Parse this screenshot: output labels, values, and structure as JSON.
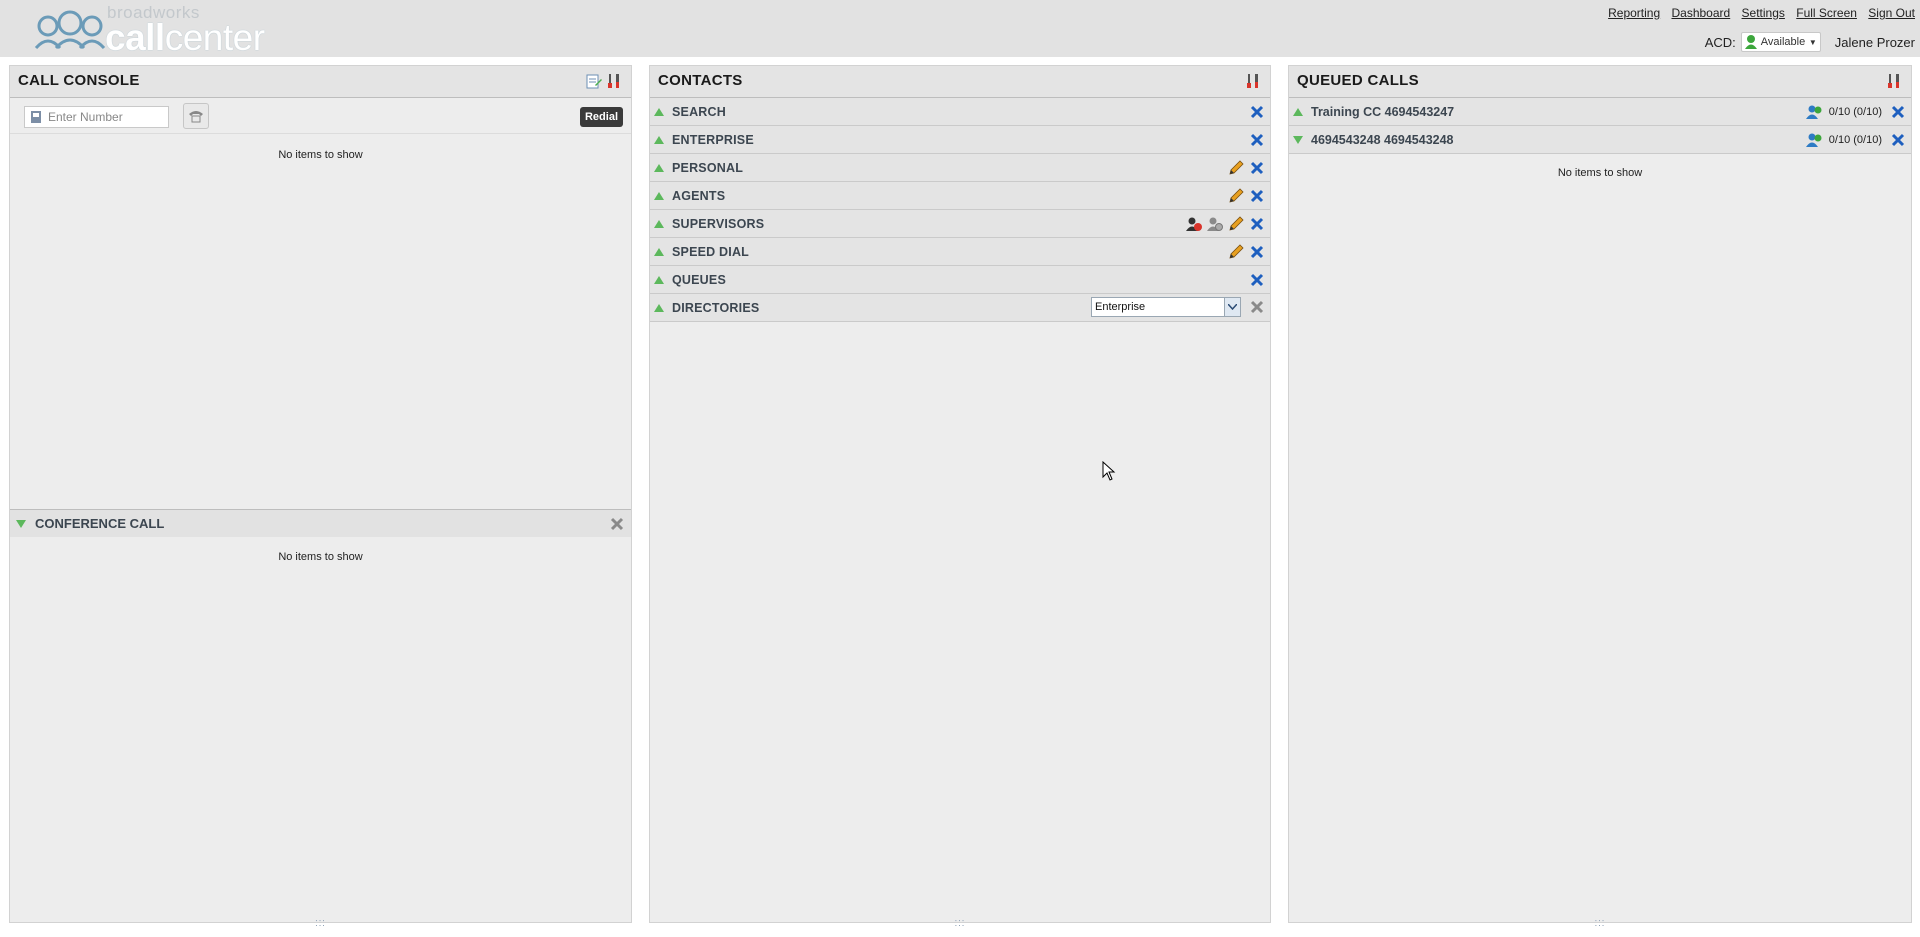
{
  "header": {
    "logo_small": "broadworks",
    "logo_big_prefix": "call",
    "logo_big_suffix": "center",
    "links": [
      "Reporting",
      "Dashboard",
      "Settings",
      "Full Screen",
      "Sign Out"
    ],
    "acd_label": "ACD:",
    "acd_status": "Available",
    "user_name": "Jalene Prozer"
  },
  "call_console": {
    "title": "CALL CONSOLE",
    "number_placeholder": "Enter Number",
    "redial_label": "Redial",
    "empty_message": "No items to show",
    "conference": {
      "title": "CONFERENCE CALL",
      "empty_message": "No items to show"
    }
  },
  "contacts": {
    "title": "CONTACTS",
    "sections": [
      {
        "label": "SEARCH"
      },
      {
        "label": "ENTERPRISE"
      },
      {
        "label": "PERSONAL"
      },
      {
        "label": "AGENTS"
      },
      {
        "label": "SUPERVISORS"
      },
      {
        "label": "SPEED DIAL"
      },
      {
        "label": "QUEUES"
      },
      {
        "label": "DIRECTORIES"
      }
    ],
    "directory_selected": "Enterprise"
  },
  "queued_calls": {
    "title": "QUEUED CALLS",
    "queues": [
      {
        "name": "Training CC 4694543247",
        "count": "0/10 (0/10)"
      },
      {
        "name": "4694543248 4694543248",
        "count": "0/10 (0/10)"
      }
    ],
    "empty_message": "No items to show"
  },
  "colors": {
    "accent_arrow": "#5cb85c",
    "close_blue": "#1e5fbf",
    "header_bg": "#e2e2e2",
    "panel_bg": "#ededed"
  }
}
